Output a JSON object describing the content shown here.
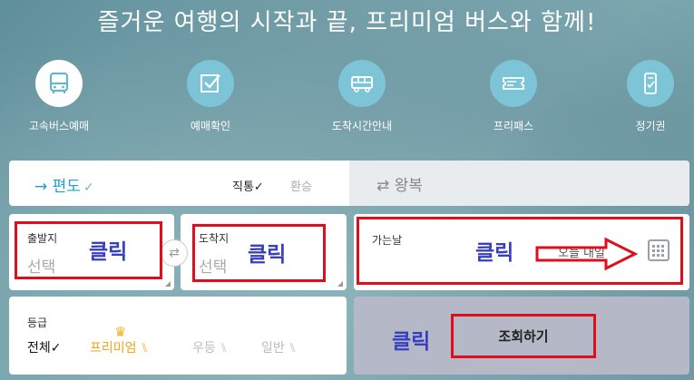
{
  "title": "즐거운 여행의 시작과 끝, 프리미엄 버스와 함께!",
  "nav": [
    {
      "label": "고속버스예매",
      "icon": "bus-icon"
    },
    {
      "label": "예매확인",
      "icon": "checkbox-icon"
    },
    {
      "label": "도착시간안내",
      "icon": "bus-side-icon"
    },
    {
      "label": "프리패스",
      "icon": "ticket-icon"
    },
    {
      "label": "정기권",
      "icon": "pass-icon"
    }
  ],
  "trip": {
    "oneway_label": "편도",
    "oneway_check": "✓",
    "direct_label": "직통",
    "direct_check": "✓",
    "transfer_label": "환승",
    "roundtrip_label": "왕복"
  },
  "departure": {
    "label": "출발지",
    "value": "선택"
  },
  "arrival": {
    "label": "도착지",
    "value": "선택"
  },
  "date": {
    "label": "가는날",
    "today_label": "오늘 내일"
  },
  "grade": {
    "label": "등급",
    "all": "전체",
    "all_check": "✓",
    "premium": "프리미엄",
    "superior": "우등",
    "normal": "일반"
  },
  "search_button": "조회하기",
  "annotations": {
    "click": "클릭"
  },
  "colors": {
    "accent": "#1fa2c8",
    "annotation_red": "#e00d1d",
    "annotation_text": "#3840c0",
    "premium": "#f1b31c"
  }
}
